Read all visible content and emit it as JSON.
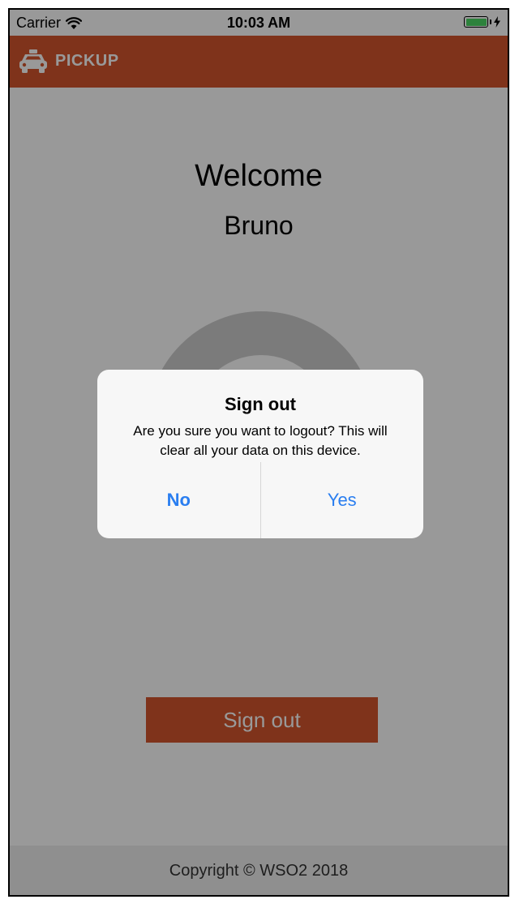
{
  "status_bar": {
    "carrier": "Carrier",
    "time": "10:03 AM",
    "icons": [
      "wifi-icon",
      "battery-icon",
      "charging-icon"
    ]
  },
  "app_bar": {
    "title": "PICKUP",
    "logo_icon": "taxi-icon",
    "color": "#d4552e"
  },
  "main": {
    "welcome": "Welcome",
    "user_name": "Bruno",
    "sign_out_label": "Sign out"
  },
  "footer": {
    "copyright": "Copyright ©  WSO2 2018"
  },
  "dialog": {
    "title": "Sign out",
    "message": "Are you sure you want to logout? This will clear all your data on this device.",
    "no_label": "No",
    "yes_label": "Yes",
    "button_color": "#2a7ef0"
  }
}
